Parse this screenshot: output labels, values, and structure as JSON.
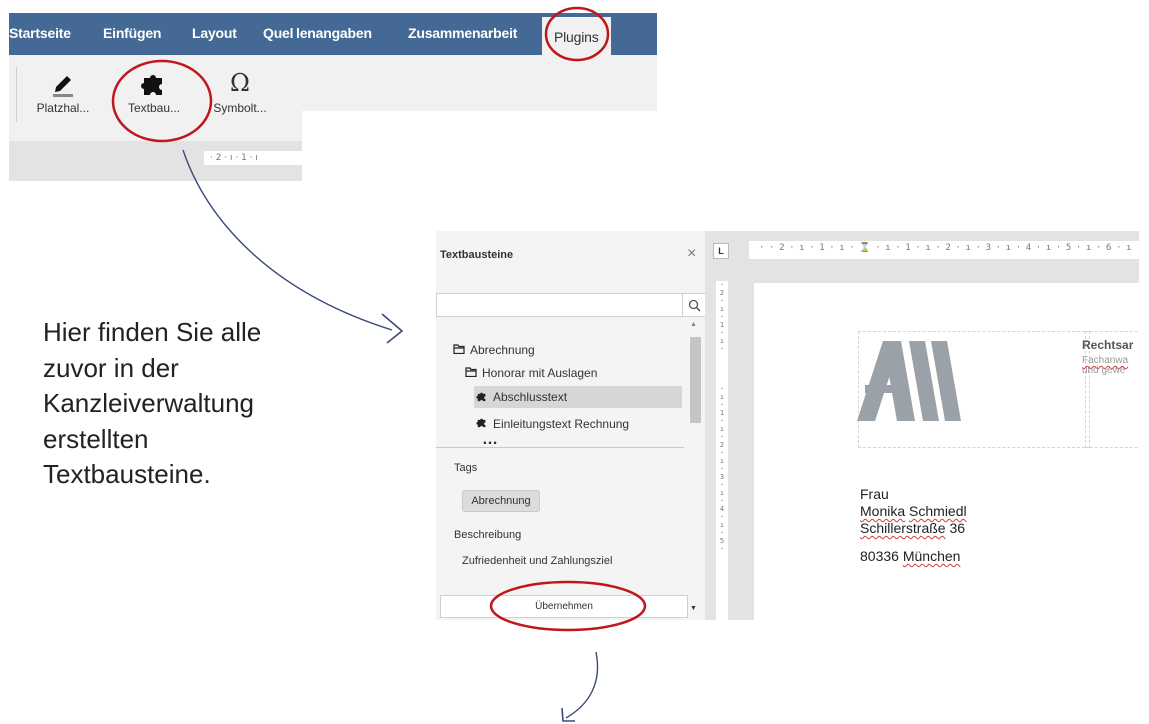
{
  "toolbar": {
    "tabs": [
      "Startseite",
      "Einfügen",
      "Layout",
      "Quel",
      "lenangaben",
      "Zusammenarbeit",
      "Plugins"
    ],
    "ribbon": [
      {
        "label": "Platzhal...",
        "icon": "pencil-icon"
      },
      {
        "label": "Textbau...",
        "icon": "puzzle-icon"
      },
      {
        "label": "Symbolt...",
        "icon": "omega-icon"
      }
    ],
    "ruler_text": "· 2 · ı · 1 · ı"
  },
  "panel": {
    "title": "Textbausteine",
    "close": "×",
    "search_value": "",
    "tree": [
      {
        "label": "Abrechnung",
        "icon": "folder-open-icon",
        "level": 0
      },
      {
        "label": "Honorar mit Auslagen",
        "icon": "folder-open-icon",
        "level": 1
      },
      {
        "label": "Abschlusstext",
        "icon": "puzzle-icon",
        "level": 2,
        "selected": true
      },
      {
        "label": "Einleitungstext Rechnung",
        "icon": "puzzle-icon",
        "level": 2
      }
    ],
    "more": "…",
    "tags_label": "Tags",
    "tag": "Abrechnung",
    "description_label": "Beschreibung",
    "description": "Zufriedenheit und Zahlungsziel",
    "apply_button": "Übernehmen"
  },
  "document": {
    "corner": "L",
    "ruler_text": "· · 2 · ı · 1 · ı · ⌛ · ı · 1 · ı · 2 · ı · 3 · ı · 4 · ı · 5 · ı · 6 · ı",
    "header_title": "Rechtsar",
    "header_sub1": "Fachanwa",
    "header_sub2": "und gewe",
    "address": {
      "salutation": "Frau",
      "first_name": "Monika",
      "last_name": "Schmiedl",
      "street": "Schillerstraße",
      "house_no": "36",
      "zip": "80336",
      "city": "München"
    }
  },
  "explain_text": "Hier finden Sie alle zuvor in der Kanzleiverwaltung erstellten Textbausteine.",
  "colors": {
    "tabbar": "#446995",
    "annotation": "#c0171d",
    "arrow": "#3b4a7a"
  }
}
